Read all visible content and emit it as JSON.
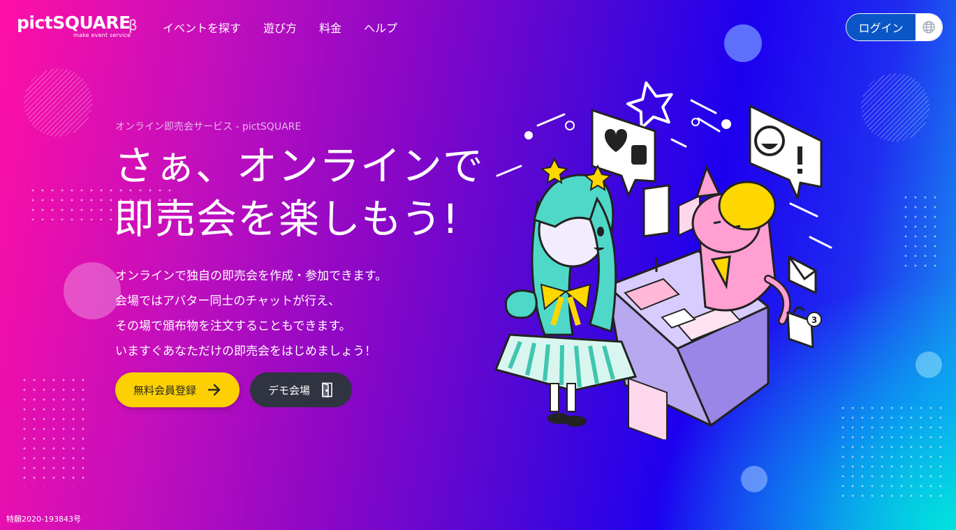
{
  "header": {
    "logo": {
      "name": "pictSQUARE",
      "beta": "β",
      "tagline": "make event service"
    },
    "nav": [
      {
        "label": "イベントを探す"
      },
      {
        "label": "遊び方"
      },
      {
        "label": "料金"
      },
      {
        "label": "ヘルプ"
      }
    ],
    "login_label": "ログイン",
    "language_icon": "globe-icon"
  },
  "hero": {
    "eyebrow": "オンライン即売会サービス - pictSQUARE",
    "headline_line1": "さぁ、オンラインで",
    "headline_line2": "即売会を楽しもう!",
    "description": [
      "オンラインで独自の即売会を作成・参加できます。",
      "会場ではアバター同士のチャットが行え、",
      "その場で頒布物を注文することもできます。",
      "いますぐあなただけの即売会をはじめましょう！"
    ],
    "register_label": "無料会員登録",
    "register_icon": "arrow-right-icon",
    "demo_label": "デモ会場",
    "demo_icon": "door-icon"
  },
  "illustration": {
    "badge_count": "3"
  },
  "footer": {
    "patent": "特願2020-193843号"
  },
  "colors": {
    "accent_yellow": "#fdd003",
    "login_blue": "#0b56c7",
    "demo_dark": "#303340"
  }
}
